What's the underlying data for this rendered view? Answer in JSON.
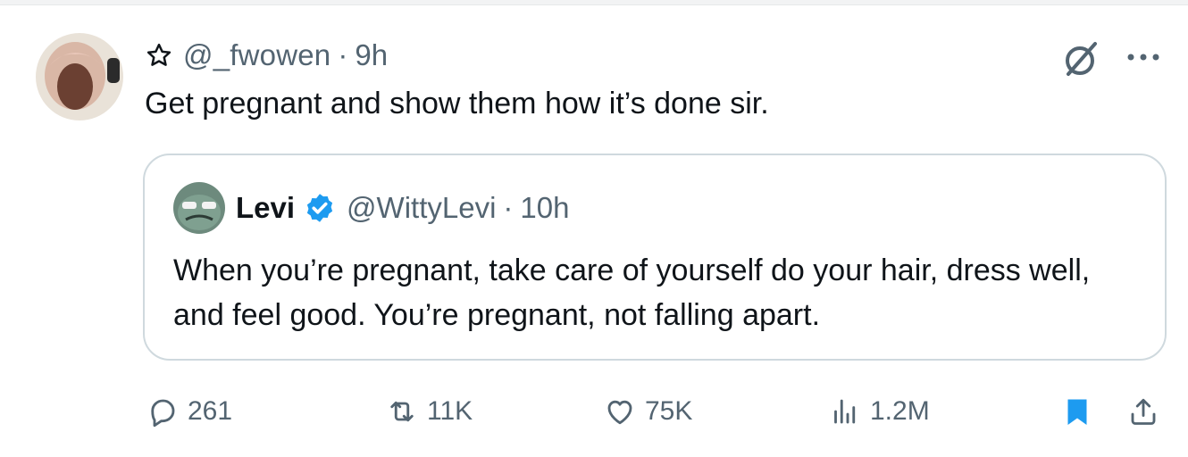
{
  "tweet": {
    "handle": "@_fwowen",
    "separator": "·",
    "time": "9h",
    "text": "Get pregnant and show them how it’s done sir."
  },
  "quote": {
    "name": "Levi",
    "handle": "@WittyLevi",
    "separator": "·",
    "time": "10h",
    "text": "When you’re pregnant, take care of yourself do your hair, dress well, and feel good. You’re pregnant, not falling apart."
  },
  "actions": {
    "replies": "261",
    "reposts": "11K",
    "likes": "75K",
    "views": "1.2M"
  },
  "colors": {
    "text": "#0f1419",
    "secondary": "#536471",
    "accent": "#1d9bf0",
    "border": "#cfd9de"
  },
  "icons": [
    "star-icon",
    "grok-icon",
    "more-icon",
    "verified-badge-icon",
    "reply-icon",
    "repost-icon",
    "like-icon",
    "views-icon",
    "bookmark-icon",
    "share-icon"
  ]
}
